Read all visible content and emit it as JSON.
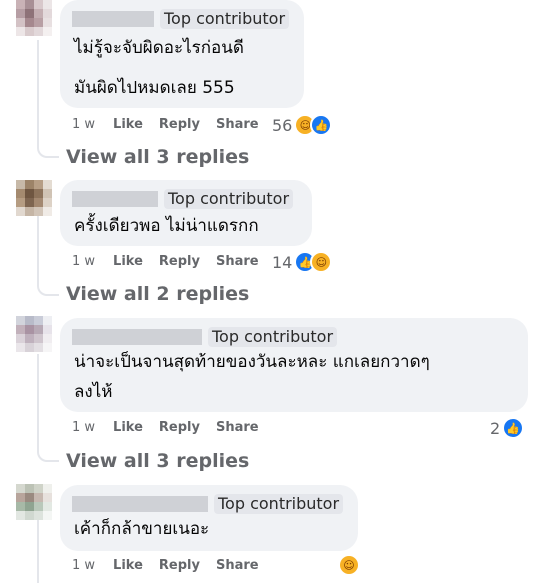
{
  "comments": [
    {
      "badge": "Top contributor",
      "lines": [
        "ไม่รู้จะจับผิดอะไรก่อนดี",
        "มันผิดไปหมดเลย 555"
      ],
      "time": "1 w",
      "like": "Like",
      "reply": "Reply",
      "share": "Share",
      "reaction_count": "56",
      "reaction_icons": [
        "haha-icon",
        "like-icon"
      ],
      "view_replies": "View all 3 replies"
    },
    {
      "badge": "Top contributor",
      "lines": [
        "ครั้งเดียวพอ ไม่น่าแดรกก"
      ],
      "time": "1 w",
      "like": "Like",
      "reply": "Reply",
      "share": "Share",
      "reaction_count": "14",
      "reaction_icons": [
        "like-icon",
        "haha-icon"
      ],
      "view_replies": "View all 2 replies"
    },
    {
      "badge": "Top contributor",
      "lines": [
        "น่าจะเป็นจานสุดท้ายของวันละหละ แกเลยกวาดๆ",
        "ลงไห้"
      ],
      "time": "1 w",
      "like": "Like",
      "reply": "Reply",
      "share": "Share",
      "reaction_count": "2",
      "reaction_icons": [
        "like-icon"
      ],
      "view_replies": "View all 3 replies"
    },
    {
      "badge": "Top contributor",
      "lines": [
        "เค้าก็กล้าขายเนอะ"
      ],
      "time": "1 w",
      "like": "Like",
      "reply": "Reply",
      "share": "Share",
      "reaction_count": "",
      "reaction_icons": [
        "haha-icon"
      ]
    }
  ],
  "colors": {
    "bubble": "#f0f2f5",
    "meta_text": "#65676b",
    "like_blue": "#1877f2",
    "haha_yellow": "#f7b125"
  }
}
